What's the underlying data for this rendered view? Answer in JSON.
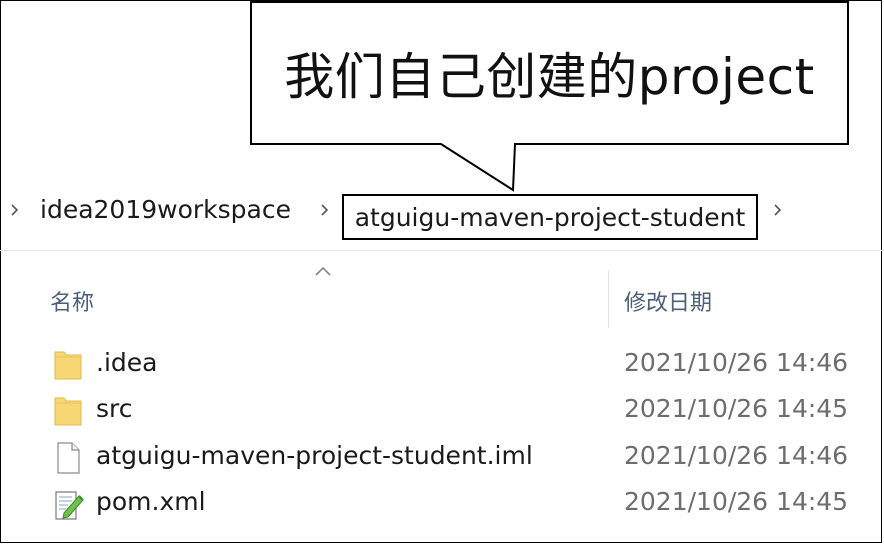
{
  "callout": {
    "text": "我们自己创建的project"
  },
  "breadcrumb": {
    "items": [
      "idea2019workspace",
      "atguigu-maven-project-student"
    ]
  },
  "columns": {
    "name": "名称",
    "date_modified": "修改日期"
  },
  "files": [
    {
      "name": ".idea",
      "date": "2021/10/26 14:46",
      "icon": "folder-icon"
    },
    {
      "name": "src",
      "date": "2021/10/26 14:45",
      "icon": "folder-icon"
    },
    {
      "name": "atguigu-maven-project-student.iml",
      "date": "2021/10/26 14:46",
      "icon": "file-icon"
    },
    {
      "name": "pom.xml",
      "date": "2021/10/26 14:45",
      "icon": "xml-file-icon"
    }
  ],
  "colors": {
    "folder": "#F8D775",
    "header_text": "#4C607A",
    "date_text": "#6D6D6D"
  }
}
